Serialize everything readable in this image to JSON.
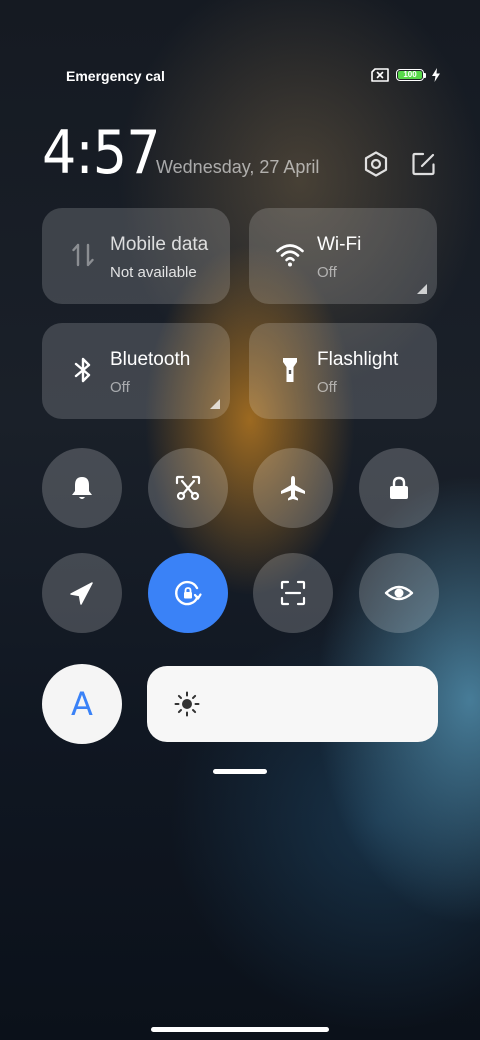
{
  "status_bar": {
    "carrier": "Emergency calls only",
    "battery_level": "100",
    "icons": [
      "no-sim-icon",
      "battery-icon",
      "charging-icon"
    ]
  },
  "header": {
    "time": "4:57",
    "date": "Wednesday, 27 April",
    "icons": [
      "settings-icon",
      "edit-icon"
    ]
  },
  "tiles": {
    "mobile_data": {
      "title": "Mobile data",
      "status": "Not available",
      "icon": "mobile-data-icon"
    },
    "wifi": {
      "title": "Wi-Fi",
      "status": "Off",
      "icon": "wifi-icon"
    },
    "bluetooth": {
      "title": "Bluetooth",
      "status": "Off",
      "icon": "bluetooth-icon"
    },
    "flashlight": {
      "title": "Flashlight",
      "status": "Off",
      "icon": "flashlight-icon"
    }
  },
  "toggles_row1": [
    {
      "name": "sound",
      "icon": "bell-icon",
      "active": false
    },
    {
      "name": "screenshot",
      "icon": "scissors-icon",
      "active": false
    },
    {
      "name": "airplane-mode",
      "icon": "airplane-icon",
      "active": false
    },
    {
      "name": "lock-screen",
      "icon": "lock-icon",
      "active": false
    }
  ],
  "toggles_row2": [
    {
      "name": "location",
      "icon": "location-arrow-icon",
      "active": false
    },
    {
      "name": "rotation-lock",
      "icon": "rotation-lock-icon",
      "active": true
    },
    {
      "name": "scanner",
      "icon": "scan-icon",
      "active": false
    },
    {
      "name": "reading-mode",
      "icon": "eye-icon",
      "active": false
    }
  ],
  "auto_brightness": {
    "label": "A",
    "icon": "auto-brightness-icon"
  },
  "brightness": {
    "icon": "sun-icon"
  },
  "colors": {
    "accent": "#3a82f7",
    "battery": "#58d84a"
  }
}
